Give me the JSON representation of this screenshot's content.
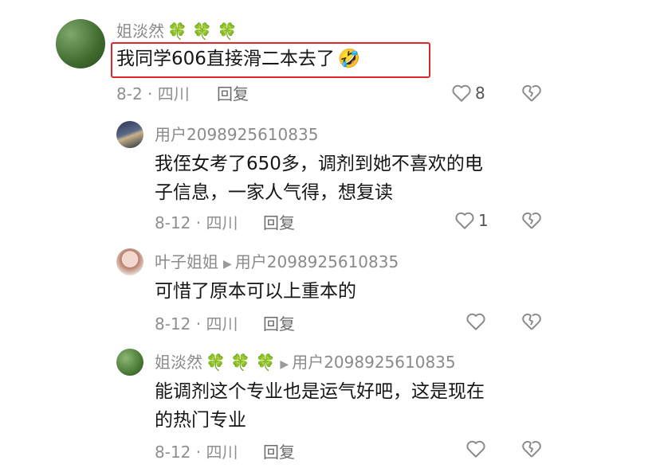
{
  "comments": [
    {
      "username": "姐淡然",
      "clovers": "🍀 🍀 🍀",
      "text": "我同学606直接滑二本去了",
      "emoji": "🤣",
      "date_location": "8-2 · 四川",
      "reply_label": "回复",
      "like_count": "8"
    },
    {
      "username": "用户2098925610835",
      "text_line1": "我侄女考了650多，调剂到她不喜欢的电",
      "text_line2": "子信息，一家人气得，想复读",
      "date_location": "8-12 · 四川",
      "reply_label": "回复",
      "like_count": "1"
    },
    {
      "username": "叶子姐姐",
      "reply_to": "用户2098925610835",
      "text": "可惜了原本可以上重本的",
      "date_location": "8-12 · 四川",
      "reply_label": "回复"
    },
    {
      "username": "姐淡然",
      "clovers": "🍀 🍀 🍀",
      "reply_to": "用户2098925610835",
      "text_line1": "能调剂这个专业也是运气好吧，这是现在",
      "text_line2": "的热门专业",
      "date_location": "8-12 · 四川",
      "reply_label": "回复"
    }
  ],
  "colors": {
    "highlight_border": "#e0272c",
    "clover": "#3fa34d",
    "meta_gray": "#8f8f8f"
  },
  "icons": {
    "like": "heart-outline-icon",
    "dislike": "broken-heart-icon",
    "reply_arrow": "triangle-right-icon"
  }
}
